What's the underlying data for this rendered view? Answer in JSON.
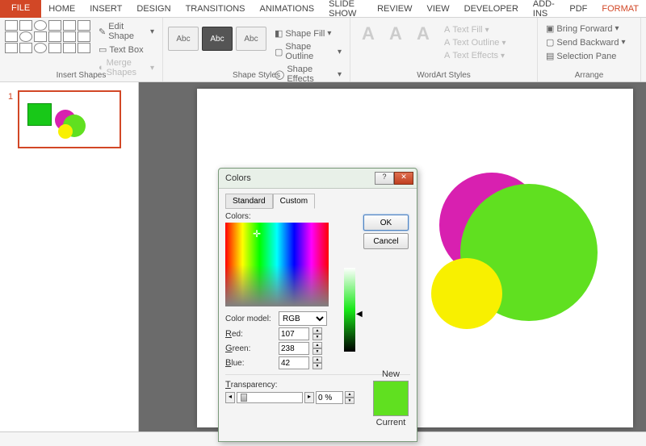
{
  "ribbon": {
    "file": "FILE",
    "tabs": [
      "HOME",
      "INSERT",
      "DESIGN",
      "TRANSITIONS",
      "ANIMATIONS",
      "SLIDE SHOW",
      "REVIEW",
      "VIEW",
      "DEVELOPER",
      "ADD-INS",
      "PDF",
      "FORMAT"
    ],
    "active_tab": "FORMAT",
    "groups": {
      "insert_shapes": {
        "label": "Insert Shapes",
        "edit_shape": "Edit Shape",
        "text_box": "Text Box",
        "merge_shapes": "Merge Shapes"
      },
      "shape_styles": {
        "label": "Shape Styles",
        "sample_text": "Abc",
        "shape_fill": "Shape Fill",
        "shape_outline": "Shape Outline",
        "shape_effects": "Shape Effects"
      },
      "wordart": {
        "label": "WordArt Styles",
        "sample": "A",
        "text_fill": "Text Fill",
        "text_outline": "Text Outline",
        "text_effects": "Text Effects"
      },
      "arrange": {
        "label": "Arrange",
        "bring_forward": "Bring Forward",
        "send_backward": "Send Backward",
        "selection_pane": "Selection Pane"
      }
    }
  },
  "thumb": {
    "number": "1"
  },
  "slide_shapes": {
    "magenta": "#d820b0",
    "green": "#60e020",
    "yellow": "#f8f000"
  },
  "dialog": {
    "title": "Colors",
    "tab_standard": "Standard",
    "tab_custom": "Custom",
    "ok": "OK",
    "cancel": "Cancel",
    "colors_label": "Colors:",
    "color_model_label": "Color model:",
    "color_model_value": "RGB",
    "red_label": "Red:",
    "green_label": "Green:",
    "blue_label": "Blue:",
    "red": "107",
    "green": "238",
    "blue": "42",
    "transparency_label": "Transparency:",
    "transparency_value": "0 %",
    "new_label": "New",
    "current_label": "Current",
    "swatch_color": "#60e020"
  }
}
